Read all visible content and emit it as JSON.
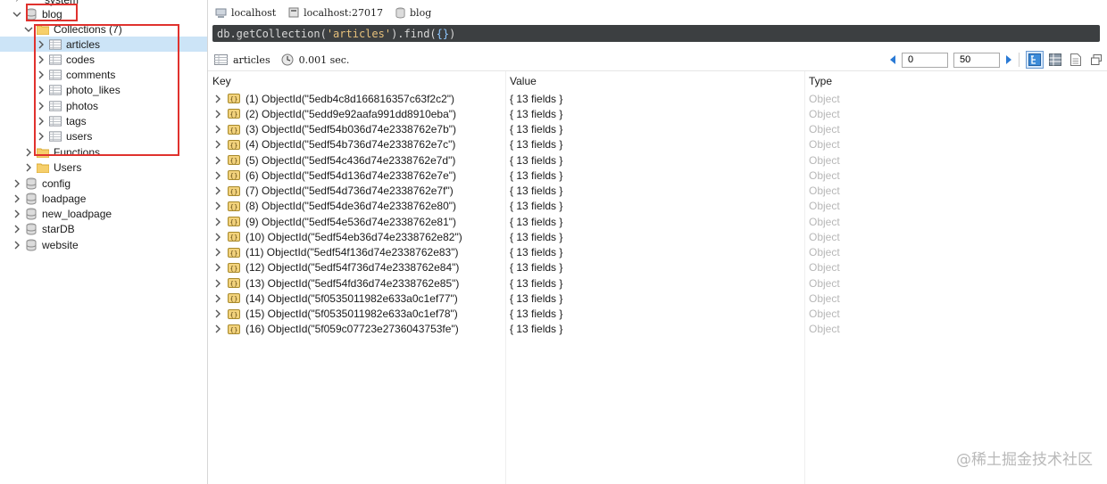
{
  "tree": {
    "partial_top": "system",
    "db_blog": "blog",
    "collections_folder": "Collections (7)",
    "collections": [
      "articles",
      "codes",
      "comments",
      "photo_likes",
      "photos",
      "tags",
      "users"
    ],
    "functions_folder": "Functions",
    "users_folder": "Users",
    "other_dbs": [
      "config",
      "loadpage",
      "new_loadpage",
      "starDB",
      "website"
    ]
  },
  "breadcrumb": {
    "host": "localhost",
    "server": "localhost:27017",
    "db": "blog"
  },
  "query": {
    "prefix": "db.getCollection(",
    "arg": "'articles'",
    "suffix": ").find(",
    "braces": "{}",
    "close": ")"
  },
  "result_bar": {
    "collection": "articles",
    "time": "0.001 sec."
  },
  "pager": {
    "skip": "0",
    "limit": "50"
  },
  "grid": {
    "headers": {
      "key": "Key",
      "value": "Value",
      "type": "Type"
    },
    "rows": [
      {
        "key": "(1) ObjectId(\"5edb4c8d166816357c63f2c2\")",
        "value": "{ 13 fields }",
        "type": "Object"
      },
      {
        "key": "(2) ObjectId(\"5edd9e92aafa991dd8910eba\")",
        "value": "{ 13 fields }",
        "type": "Object"
      },
      {
        "key": "(3) ObjectId(\"5edf54b036d74e2338762e7b\")",
        "value": "{ 13 fields }",
        "type": "Object"
      },
      {
        "key": "(4) ObjectId(\"5edf54b736d74e2338762e7c\")",
        "value": "{ 13 fields }",
        "type": "Object"
      },
      {
        "key": "(5) ObjectId(\"5edf54c436d74e2338762e7d\")",
        "value": "{ 13 fields }",
        "type": "Object"
      },
      {
        "key": "(6) ObjectId(\"5edf54d136d74e2338762e7e\")",
        "value": "{ 13 fields }",
        "type": "Object"
      },
      {
        "key": "(7) ObjectId(\"5edf54d736d74e2338762e7f\")",
        "value": "{ 13 fields }",
        "type": "Object"
      },
      {
        "key": "(8) ObjectId(\"5edf54de36d74e2338762e80\")",
        "value": "{ 13 fields }",
        "type": "Object"
      },
      {
        "key": "(9) ObjectId(\"5edf54e536d74e2338762e81\")",
        "value": "{ 13 fields }",
        "type": "Object"
      },
      {
        "key": "(10) ObjectId(\"5edf54eb36d74e2338762e82\")",
        "value": "{ 13 fields }",
        "type": "Object"
      },
      {
        "key": "(11) ObjectId(\"5edf54f136d74e2338762e83\")",
        "value": "{ 13 fields }",
        "type": "Object"
      },
      {
        "key": "(12) ObjectId(\"5edf54f736d74e2338762e84\")",
        "value": "{ 13 fields }",
        "type": "Object"
      },
      {
        "key": "(13) ObjectId(\"5edf54fd36d74e2338762e85\")",
        "value": "{ 13 fields }",
        "type": "Object"
      },
      {
        "key": "(14) ObjectId(\"5f0535011982e633a0c1ef77\")",
        "value": "{ 13 fields }",
        "type": "Object"
      },
      {
        "key": "(15) ObjectId(\"5f0535011982e633a0c1ef78\")",
        "value": "{ 13 fields }",
        "type": "Object"
      },
      {
        "key": "(16) ObjectId(\"5f059c07723e2736043753fe\")",
        "value": "{ 13 fields }",
        "type": "Object"
      }
    ]
  },
  "watermark": "@稀土掘金技术社区",
  "colors": {
    "selection": "#cce4f7",
    "highlight_box": "#e0322e",
    "query_bg": "#3c3f41",
    "type_text": "#b7b7b7"
  }
}
